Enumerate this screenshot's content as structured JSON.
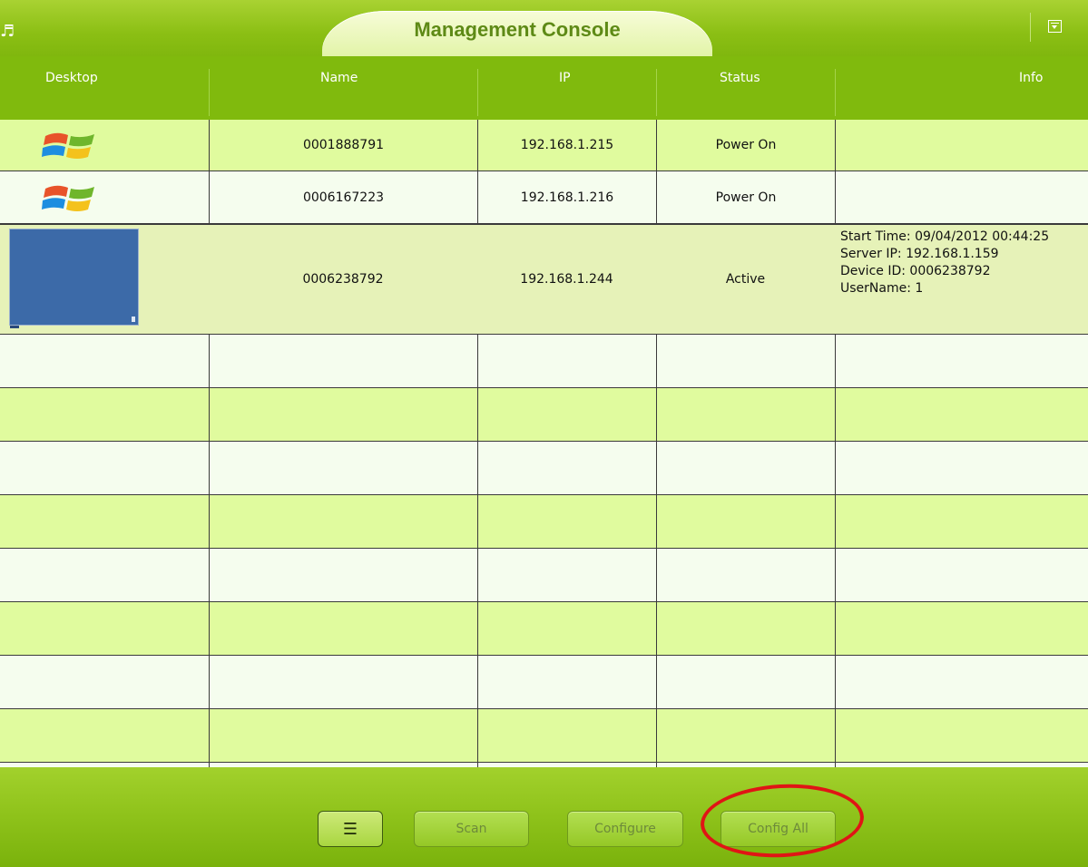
{
  "app": {
    "title": "Management Console"
  },
  "columns": [
    "Desktop",
    "Name",
    "IP",
    "Status",
    "Info"
  ],
  "rows": [
    {
      "desktop": "windows-logo-icon",
      "name": "0001888791",
      "ip": "192.168.1.215",
      "status": "Power On",
      "info": []
    },
    {
      "desktop": "windows-logo-icon",
      "name": "0006167223",
      "ip": "192.168.1.216",
      "status": "Power On",
      "info": []
    },
    {
      "desktop": "desktop-thumbnail",
      "name": "0006238792",
      "ip": "192.168.1.244",
      "status": "Active",
      "info": [
        "Start Time: 09/04/2012 00:44:25",
        "Server IP: 192.168.1.159",
        "Device ID: 0006238792",
        "UserName: 1"
      ]
    }
  ],
  "empty_row_count": 9,
  "footer": {
    "list_icon": "list-icon",
    "scan_label": "Scan",
    "configure_label": "Configure",
    "config_all_label": "Config All"
  },
  "colors": {
    "header_green": "#80ba0d",
    "row_light_green": "#e0fb9e",
    "row_white": "#f5fdee",
    "annotation_red": "#e01515",
    "thumbnail_blue": "#3c6aa8"
  }
}
